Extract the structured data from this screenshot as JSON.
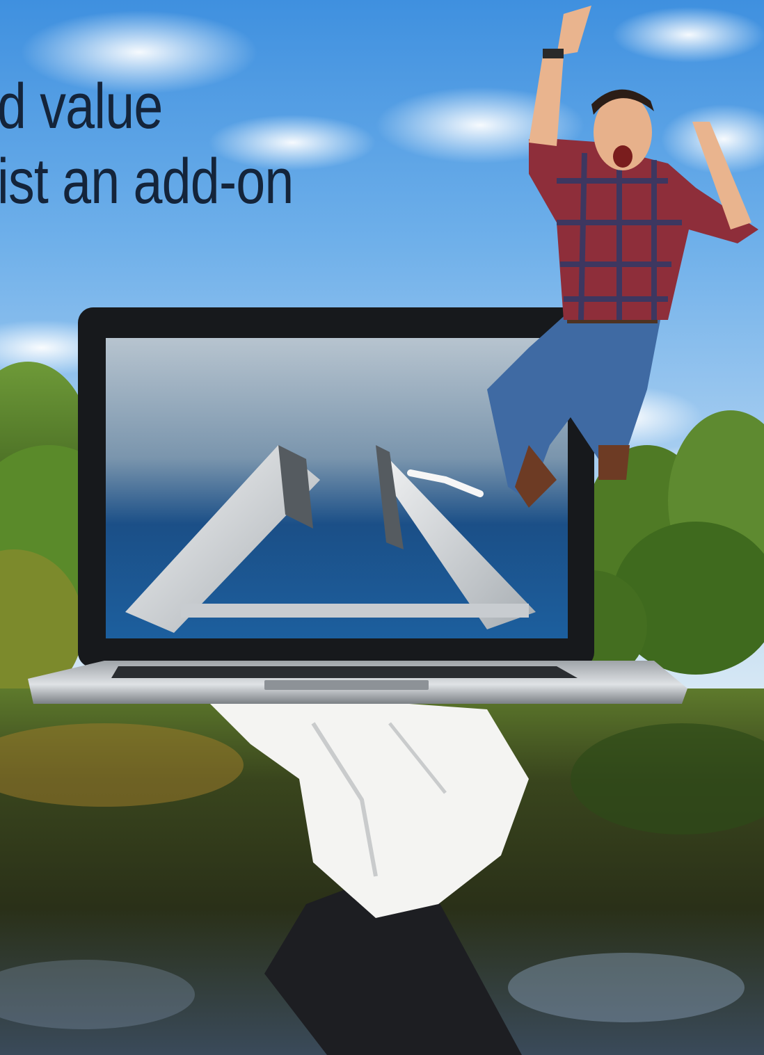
{
  "headline": {
    "line1": "d value",
    "line2": "ist an add-on"
  },
  "colors": {
    "sky_top": "#3f90df",
    "headline_text": "#14243a",
    "trees": "#4f7a25",
    "water": "#2a3018",
    "laptop_bezel": "#17191c",
    "glove": "#f4f4f2",
    "sleeve": "#1d1e22"
  },
  "icons": [
    "cloud-icon",
    "tree-icon",
    "laptop-icon",
    "window-frame-icon",
    "person-icon",
    "hand-icon"
  ]
}
